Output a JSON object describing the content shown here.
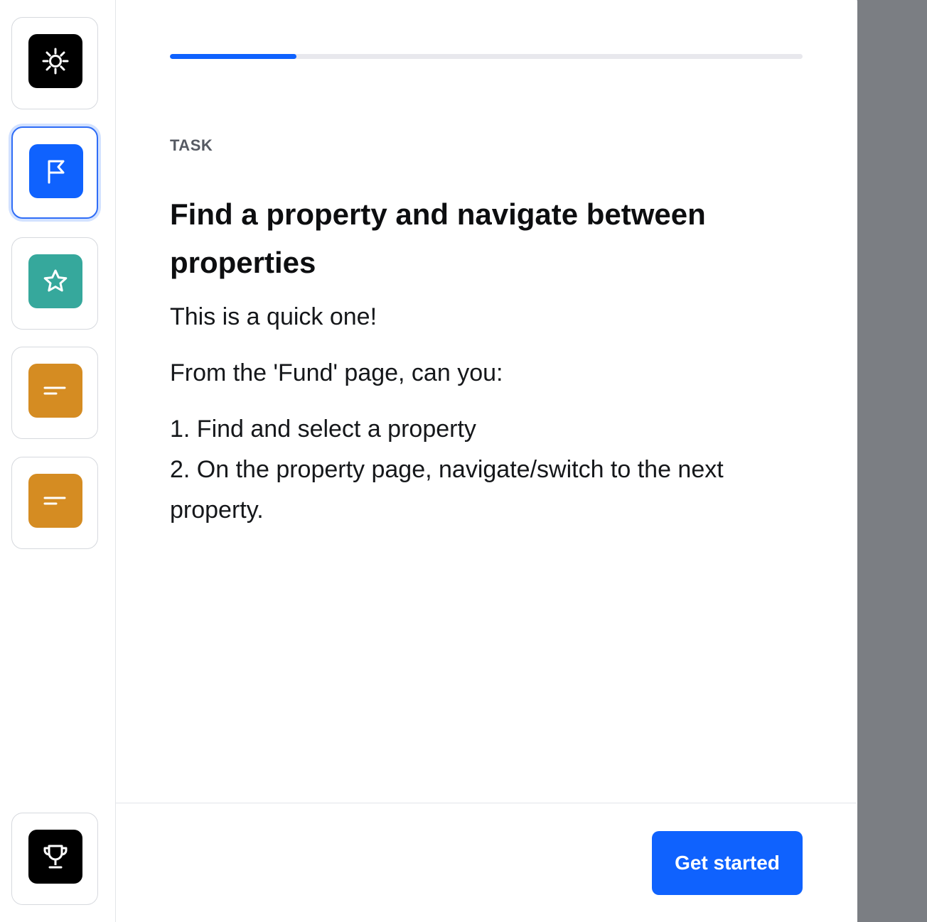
{
  "sidebar": {
    "steps": [
      {
        "icon": "settings-icon",
        "color": "#000000",
        "active": false
      },
      {
        "icon": "flag-icon",
        "color": "#0f62fe",
        "active": true
      },
      {
        "icon": "star-icon",
        "color": "#36a89c",
        "active": false
      },
      {
        "icon": "text-lines-icon",
        "color": "#d58c22",
        "active": false
      },
      {
        "icon": "text-lines-icon",
        "color": "#d58c22",
        "active": false
      }
    ],
    "trophy": {
      "icon": "trophy-icon",
      "color": "#000000"
    }
  },
  "progress": {
    "fraction": 0.2,
    "color": "#0f62fe"
  },
  "content": {
    "eyebrow": "TASK",
    "title": "Find a property and navigate between properties",
    "intro": "This is a quick one!",
    "lead": "From the 'Fund' page, can you:",
    "steps": [
      "1. Find and select a property",
      "2. On the property page, navigate/switch to the next property."
    ]
  },
  "footer": {
    "cta_label": "Get started"
  }
}
